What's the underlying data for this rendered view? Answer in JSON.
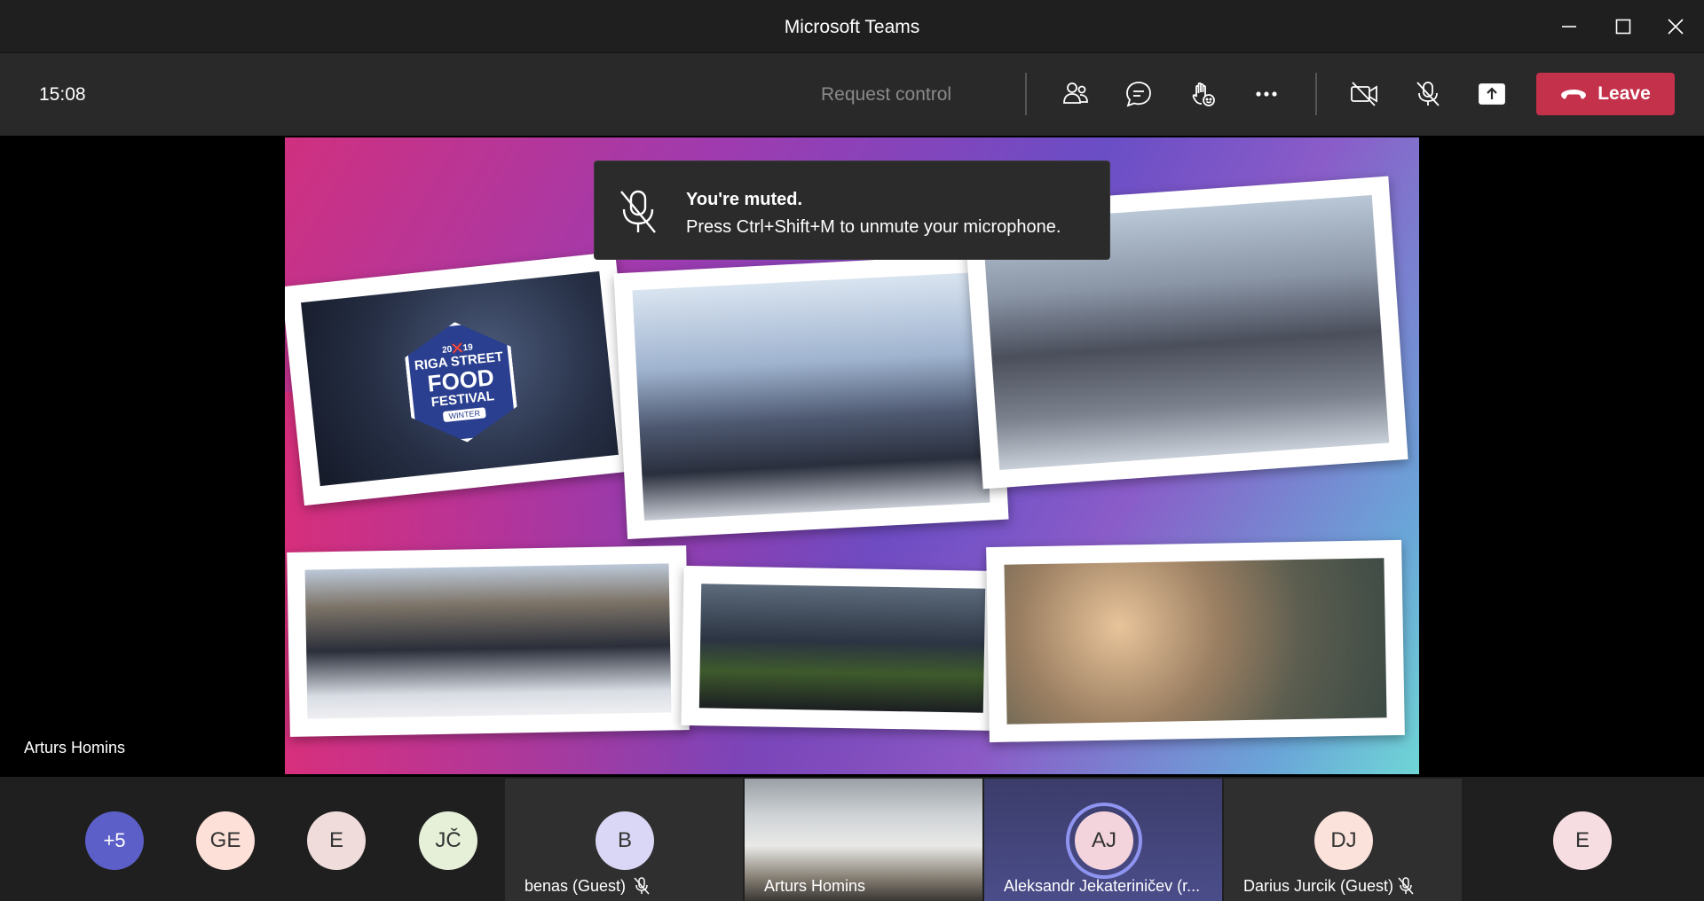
{
  "window": {
    "title": "Microsoft Teams"
  },
  "toolbar": {
    "timer": "15:08",
    "request_control": "Request control",
    "leave_label": "Leave"
  },
  "toast": {
    "title": "You're muted.",
    "message": "Press Ctrl+Shift+M to unmute your microphone."
  },
  "slide": {
    "badge_year": "20❌19",
    "badge_line1": "RIGA STREET",
    "badge_line2": "FOOD",
    "badge_line3": "FESTIVAL",
    "badge_tag": "WINTER"
  },
  "presenter": {
    "name": "Arturs Homins"
  },
  "participants": {
    "overflow": "+5",
    "avatars": [
      "GE",
      "E",
      "JČ"
    ],
    "tiles": [
      {
        "initials": "B",
        "name": "benas (Guest)"
      },
      {
        "initials": "",
        "name": "Arturs Homins"
      },
      {
        "initials": "AJ",
        "name": "Aleksandr Jekateriničev (r..."
      },
      {
        "initials": "DJ",
        "name": "Darius Jurcik (Guest)"
      }
    ],
    "last_avatar": "E"
  },
  "colors": {
    "leave": "#c4314b",
    "overflow_badge": "#5b5fc7",
    "active_ring": "#8f94f0"
  },
  "icons": {
    "participants": "people-icon",
    "chat": "chat-icon",
    "reactions": "raise-hand-icon",
    "more": "more-icon",
    "camera": "camera-off-icon",
    "mic": "mic-off-icon",
    "share": "share-icon",
    "leave": "phone-hangup-icon"
  }
}
